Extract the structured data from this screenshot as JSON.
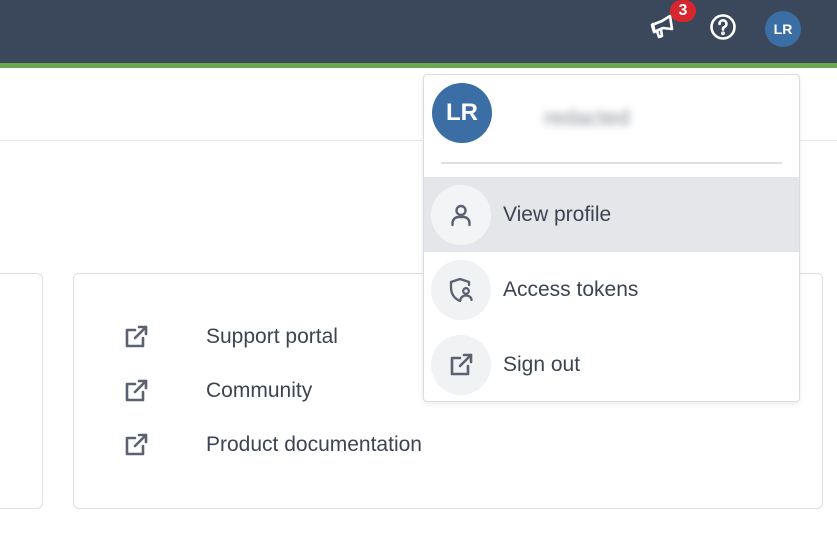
{
  "topbar": {
    "notifications": {
      "icon": "megaphone-icon",
      "badge_count": "3",
      "badge_color": "#d7262e"
    },
    "help": {
      "icon": "help-circle-icon"
    },
    "avatar_initials": "LR",
    "colors": {
      "bar": "#3b475b",
      "accent": "#6aa84f",
      "avatar": "#3b6ea5"
    }
  },
  "resources": {
    "links": [
      {
        "label": "Support portal",
        "icon": "external-link-icon"
      },
      {
        "label": "Community",
        "icon": "external-link-icon"
      },
      {
        "label": "Product documentation",
        "icon": "external-link-icon"
      }
    ]
  },
  "user_menu": {
    "avatar_initials": "LR",
    "user_name": "redacted",
    "items": [
      {
        "label": "View profile",
        "icon": "user-icon",
        "active": true
      },
      {
        "label": "Access tokens",
        "icon": "shield-user-icon",
        "active": false
      },
      {
        "label": "Sign out",
        "icon": "external-link-icon",
        "active": false
      }
    ]
  }
}
